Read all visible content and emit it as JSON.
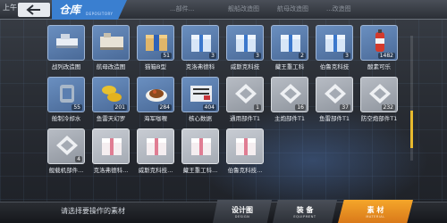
{
  "header": {
    "top_left_text": "上午",
    "title": "仓库",
    "title_sub": "DEPOSITORY",
    "faded_labels": [
      "...部件...",
      "舰船改造图",
      "航母改造图",
      "...改造图"
    ]
  },
  "items": [
    {
      "label": "战列改造图",
      "count": "",
      "tile": "blue",
      "icon": "battleship-blueprint-icon"
    },
    {
      "label": "航母改造图",
      "count": "",
      "tile": "blue",
      "icon": "carrier-blueprint-icon"
    },
    {
      "label": "猫箱B型",
      "count": "51",
      "tile": "blue",
      "icon": "cat-box-icon"
    },
    {
      "label": "克洛弗德科",
      "count": "3",
      "tile": "blue",
      "icon": "gift-box-icon"
    },
    {
      "label": "威斯克科技",
      "count": "3",
      "tile": "blue",
      "icon": "gift-box-icon"
    },
    {
      "label": "藏王重工科",
      "count": "2",
      "tile": "blue",
      "icon": "gift-box-icon"
    },
    {
      "label": "伯鲁克科技",
      "count": "3",
      "tile": "blue",
      "icon": "gift-box-icon"
    },
    {
      "label": "酸素可乐",
      "count": "1482",
      "tile": "blue",
      "icon": "cola-bottle-icon"
    },
    {
      "label": "舱制冷却水",
      "count": "55",
      "tile": "blue",
      "icon": "coolant-icon"
    },
    {
      "label": "鱼雷天幻罗",
      "count": "201",
      "tile": "blue",
      "icon": "torpedo-icon"
    },
    {
      "label": "海军咖喱",
      "count": "284",
      "tile": "blue",
      "icon": "curry-icon"
    },
    {
      "label": "核心数据",
      "count": "404",
      "tile": "blue",
      "icon": "data-core-icon"
    },
    {
      "label": "通用部件T1",
      "count": "1",
      "tile": "gray",
      "icon": "part-plate-icon"
    },
    {
      "label": "主炮部件T1",
      "count": "16",
      "tile": "gray",
      "icon": "part-plate-icon"
    },
    {
      "label": "鱼雷部件T1",
      "count": "37",
      "tile": "gray",
      "icon": "part-plate-icon"
    },
    {
      "label": "防空炮部件T1",
      "count": "232",
      "tile": "gray",
      "icon": "part-plate-icon"
    },
    {
      "label": "舰载机部件...",
      "count": "4",
      "tile": "gray",
      "icon": "part-plate-icon"
    },
    {
      "label": "克洛弗德科...",
      "count": "",
      "tile": "pink",
      "icon": "pink-box-icon"
    },
    {
      "label": "威斯克科技...",
      "count": "",
      "tile": "pink",
      "icon": "pink-box-icon"
    },
    {
      "label": "藏王重工科...",
      "count": "",
      "tile": "pink",
      "icon": "pink-box-icon"
    },
    {
      "label": "伯鲁克科技...",
      "count": "",
      "tile": "pink",
      "icon": "pink-box-icon"
    }
  ],
  "footer": {
    "hint": "请选择要操作的素材",
    "tabs": [
      {
        "label": "设计图",
        "sub": "DESIGN",
        "active": false
      },
      {
        "label": "装 备",
        "sub": "EQUIPMENT",
        "active": false
      },
      {
        "label": "素 材",
        "sub": "MATERIAL",
        "active": true
      }
    ]
  },
  "colors": {
    "accent_blue": "#3a7fd0",
    "active_tab": "#f5a62a",
    "scroll_thumb": "#e8ba2e"
  }
}
